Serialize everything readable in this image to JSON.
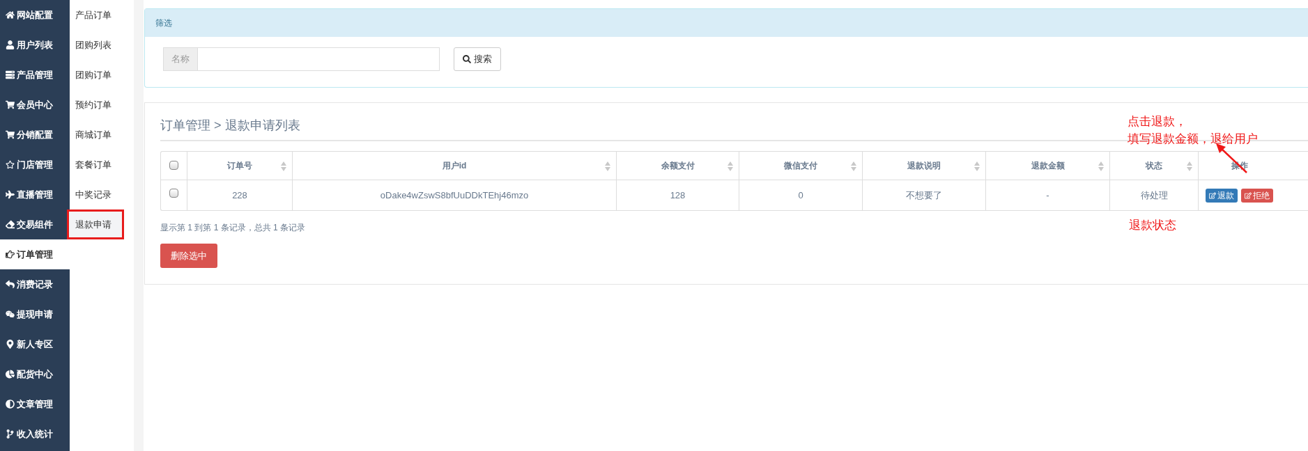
{
  "sidebar": {
    "items": [
      {
        "label": "网站配置",
        "selected": false
      },
      {
        "label": "用户列表",
        "selected": false
      },
      {
        "label": "产品管理",
        "selected": false
      },
      {
        "label": "会员中心",
        "selected": false
      },
      {
        "label": "分销配置",
        "selected": false
      },
      {
        "label": "门店管理",
        "selected": false
      },
      {
        "label": "直播管理",
        "selected": false
      },
      {
        "label": "交易组件",
        "selected": false
      },
      {
        "label": "订单管理",
        "selected": true
      },
      {
        "label": "消费记录",
        "selected": false
      },
      {
        "label": "提现申请",
        "selected": false
      },
      {
        "label": "新人专区",
        "selected": false
      },
      {
        "label": "配货中心",
        "selected": false
      },
      {
        "label": "文章管理",
        "selected": false
      },
      {
        "label": "收入统计",
        "selected": false
      }
    ]
  },
  "submenu": {
    "items": [
      {
        "label": "产品订单",
        "selected": false
      },
      {
        "label": "团购列表",
        "selected": false
      },
      {
        "label": "团购订单",
        "selected": false
      },
      {
        "label": "预约订单",
        "selected": false
      },
      {
        "label": "商城订单",
        "selected": false
      },
      {
        "label": "套餐订单",
        "selected": false
      },
      {
        "label": "中奖记录",
        "selected": false
      },
      {
        "label": "退款申请",
        "selected": true
      }
    ]
  },
  "filter": {
    "title": "筛选",
    "field_label": "名称",
    "search_button": "搜索"
  },
  "list": {
    "breadcrumb": "订单管理 > 退款申请列表",
    "columns": [
      {
        "label": "订单号",
        "sortable": true
      },
      {
        "label": "用户id",
        "sortable": true
      },
      {
        "label": "余额支付",
        "sortable": true
      },
      {
        "label": "微信支付",
        "sortable": true
      },
      {
        "label": "退款说明",
        "sortable": true
      },
      {
        "label": "退款金额",
        "sortable": true
      },
      {
        "label": "状态",
        "sortable": true
      },
      {
        "label": "操作",
        "sortable": false
      }
    ],
    "header_checked": false,
    "rows": [
      {
        "checked": false,
        "cells": [
          "228",
          "oDake4wZswS8bfUuDDkTEhj46mzo",
          "128",
          "0",
          "不想要了",
          "-",
          "待处理"
        ],
        "actions": [
          {
            "label": "退款",
            "kind": "primary"
          },
          {
            "label": "拒绝",
            "kind": "danger"
          }
        ]
      }
    ],
    "pagination_info": "显示第 1 到第 1 条记录，总共 1 条记录",
    "delete_button": "删除选中"
  },
  "annotations": {
    "action_note": [
      "点击退款，",
      "填写退款金额，退给用户"
    ],
    "status_note": "退款状态"
  }
}
